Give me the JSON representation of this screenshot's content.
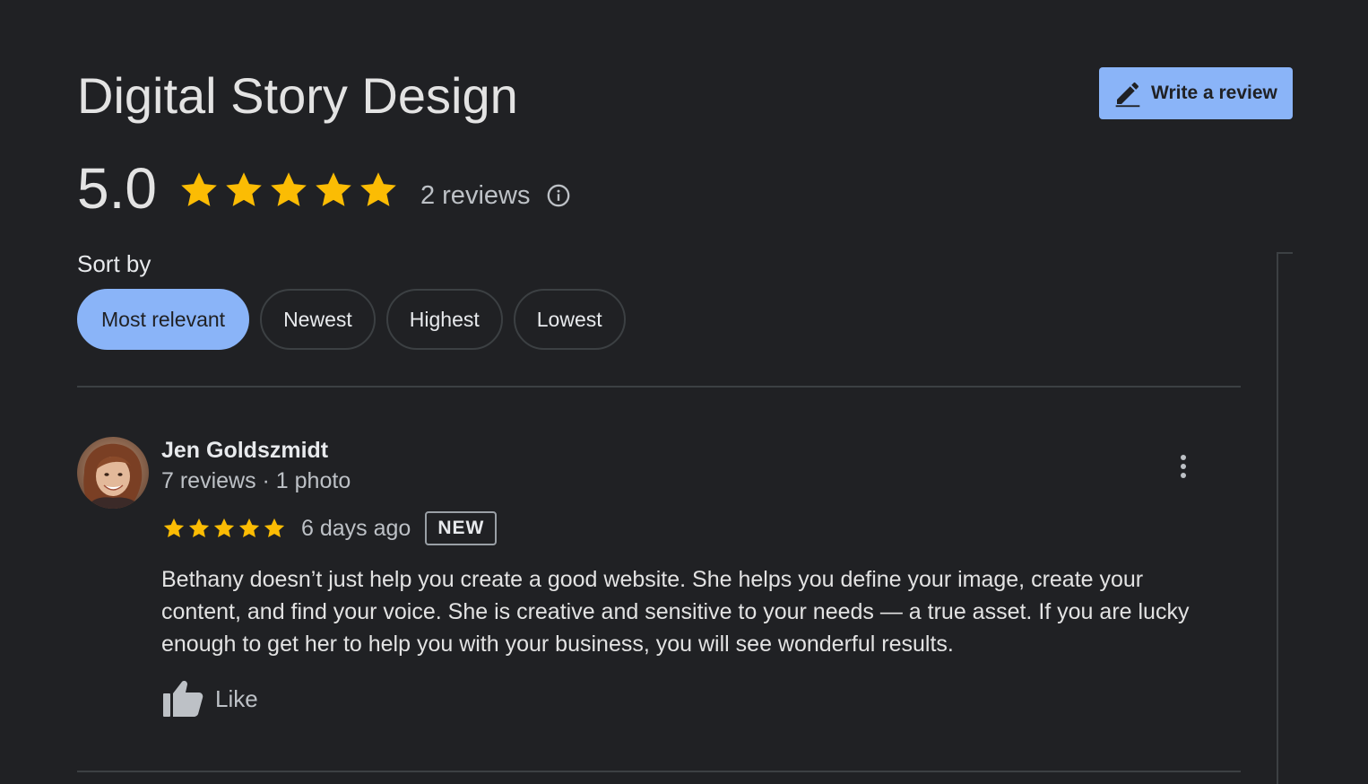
{
  "business": {
    "title": "Digital Story Design"
  },
  "write_review": {
    "label": "Write a review",
    "icon": "pencil-icon"
  },
  "rating": {
    "value": "5.0",
    "stars": 5,
    "review_count": "2 reviews",
    "info_icon": "info-icon"
  },
  "sort": {
    "label": "Sort by",
    "options": [
      "Most relevant",
      "Newest",
      "Highest",
      "Lowest"
    ],
    "selected": "Most relevant"
  },
  "reviews": [
    {
      "name": "Jen Goldszmidt",
      "meta": "7 reviews · 1 photo",
      "stars": 5,
      "date": "6 days ago",
      "badge": "NEW",
      "text": "Bethany doesn’t just help you create a good website. She helps you define your image, create your content, and find your voice. She is creative and sensitive to your needs — a true asset. If you are lucky enough to get her to help you with your business, you will see wonderful results.",
      "like_label": "Like"
    }
  ],
  "colors": {
    "background": "#202124",
    "accent": "#8ab4f8",
    "star": "#fbbc04",
    "divider": "#3c4043"
  }
}
